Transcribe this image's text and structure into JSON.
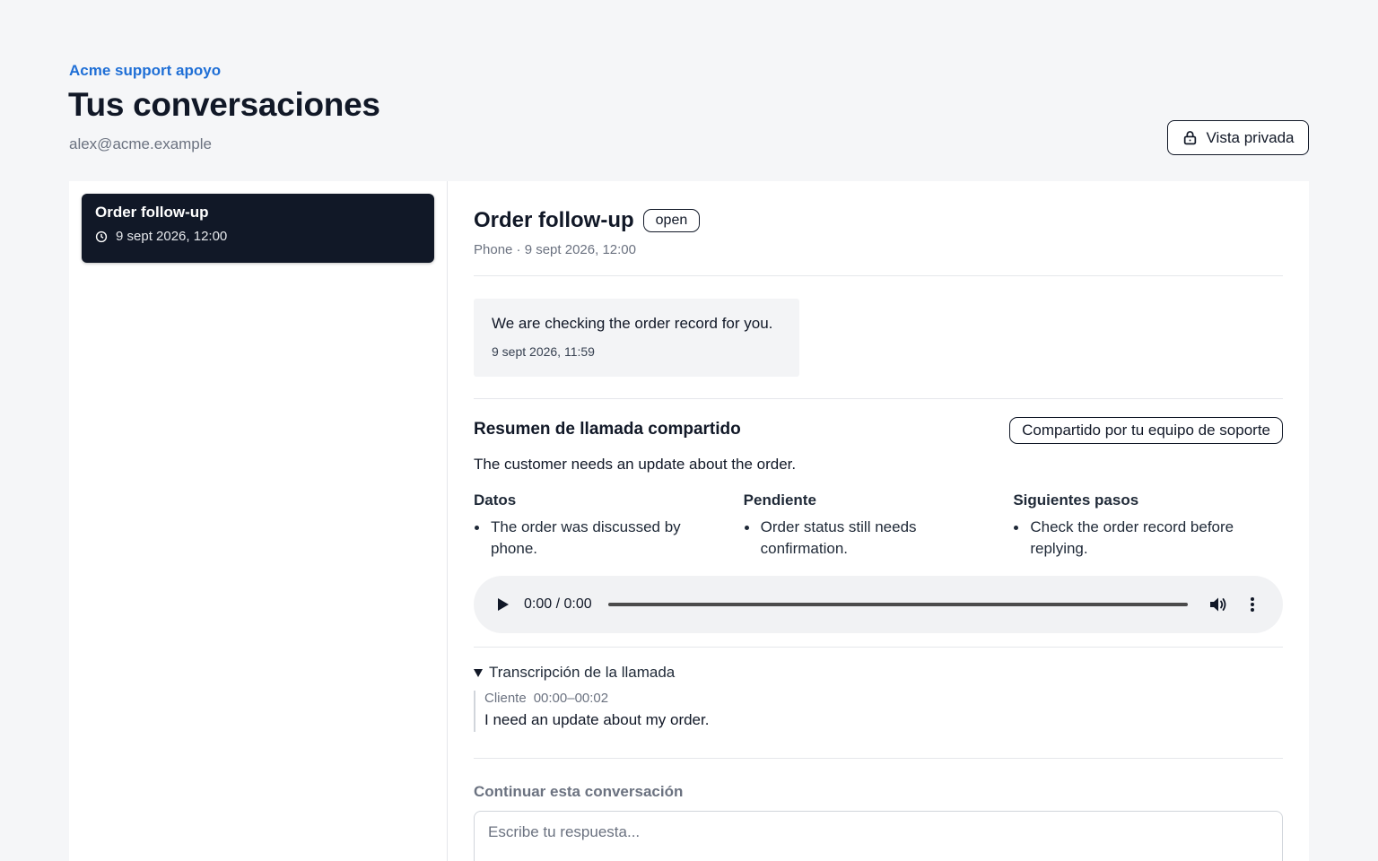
{
  "header": {
    "brand": "Acme support apoyo",
    "title": "Tus conversaciones",
    "account_email": "alex@acme.example",
    "private_view_label": "Vista privada"
  },
  "sidebar": {
    "conversations": [
      {
        "title": "Order follow-up",
        "datetime": "9 sept 2026, 12:00",
        "selected": true
      }
    ]
  },
  "conversation": {
    "title": "Order follow-up",
    "status": "open",
    "meta": "Phone · 9 sept 2026, 12:00",
    "messages": [
      {
        "text": "We are checking the order record for you.",
        "time": "9 sept 2026, 11:59"
      }
    ]
  },
  "call_summary": {
    "heading": "Resumen de llamada compartido",
    "shared_badge": "Compartido por tu equipo de soporte",
    "summary": "The customer needs an update about the order.",
    "sections": [
      {
        "title": "Datos",
        "items": [
          "The order was discussed by phone."
        ]
      },
      {
        "title": "Pendiente",
        "items": [
          "Order status still needs confirmation."
        ]
      },
      {
        "title": "Siguientes pasos",
        "items": [
          "Check the order record before replying."
        ]
      }
    ]
  },
  "audio": {
    "time_display": "0:00 / 0:00",
    "progress": 0
  },
  "transcript": {
    "summary_label": "Transcripción de la llamada",
    "expanded": true,
    "entries": [
      {
        "speaker": "Cliente",
        "range": "00:00–00:02",
        "text": "I need an update about my order."
      }
    ]
  },
  "reply": {
    "label": "Continuar esta conversación",
    "placeholder": "Escribe tu respuesta..."
  },
  "colors": {
    "brand": "#1f6fd6",
    "selected_item_bg": "#111827",
    "page_bg": "#f5f6f8"
  }
}
